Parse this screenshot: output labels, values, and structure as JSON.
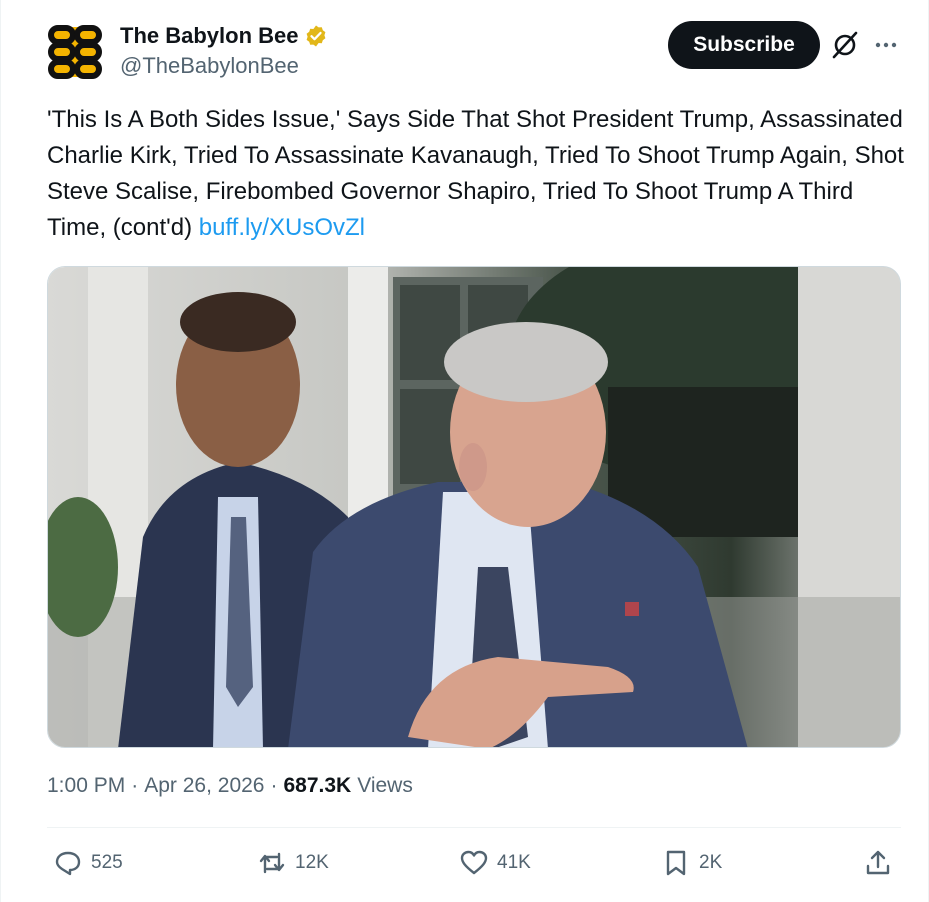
{
  "account": {
    "display_name": "The Babylon Bee",
    "handle": "@TheBabylonBee",
    "verified": true,
    "logo_icon": "bee-logo-icon"
  },
  "header": {
    "subscribe_label": "Subscribe",
    "grok_icon": "grok-icon",
    "more_icon": "more-icon"
  },
  "tweet": {
    "text": "'This Is A Both Sides Issue,' Says Side That Shot President Trump, Assassinated Charlie Kirk, Tried To Assassinate Kavanaugh, Tried To Shoot Trump Again, Shot Steve Scalise, Firebombed Governor Shapiro, Tried To Shoot Trump A Third Time, (cont'd)",
    "link_text": "buff.ly/XUsOvZl"
  },
  "meta": {
    "time": "1:00 PM",
    "separator": "·",
    "date": "Apr 26, 2026",
    "views_count": "687.3K",
    "views_label": "Views"
  },
  "actions": {
    "replies": "525",
    "reposts": "12K",
    "likes": "41K",
    "bookmarks": "2K"
  },
  "colors": {
    "accent": "#1d9bf0",
    "text_primary": "#0f1419",
    "text_secondary": "#536471",
    "verified_gold": "#e2b719",
    "logo_yellow": "#f4b400"
  }
}
